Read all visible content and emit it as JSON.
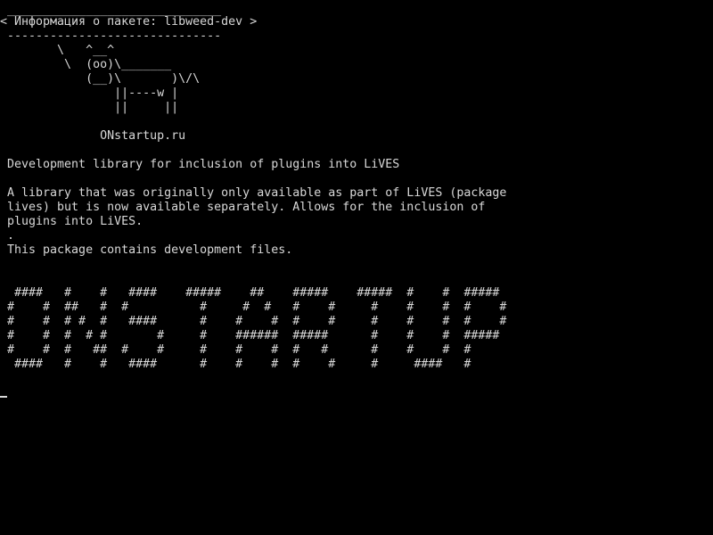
{
  "terminal": {
    "colors": {
      "background": "#000000",
      "foreground": "#d8d8d8"
    },
    "cowsay": {
      "top_border": " ______________________________",
      "message": "< Информация о пакете: libweed-dev >",
      "bottom_border": " ------------------------------",
      "cow": [
        "        \\   ^__^",
        "         \\  (oo)\\_______",
        "            (__)\\       )\\/\\",
        "                ||----w |",
        "                ||     ||"
      ]
    },
    "site_name": "              ONstartup.ru",
    "description": {
      "summary": " Development library for inclusion of plugins into LiVES",
      "body": [
        " A library that was originally only available as part of LiVES (package",
        " lives) but is now available separately. Allows for the inclusion of",
        " plugins into LiVES.",
        " .",
        " This package contains development files."
      ]
    },
    "banner": [
      "  ####   #    #   ####    #####    ##    #####    #####  #    #  #####",
      " #    #  ##   #  #          #     #  #   #    #     #    #    #  #    #",
      " #    #  # #  #   ####      #    #    #  #    #     #    #    #  #    #",
      " #    #  #  # #       #     #    ######  #####      #    #    #  #####",
      " #    #  #   ##  #    #     #    #    #  #   #      #    #    #  #",
      "  ####   #    #   ####      #    #    #  #    #     #     ####   #"
    ]
  }
}
